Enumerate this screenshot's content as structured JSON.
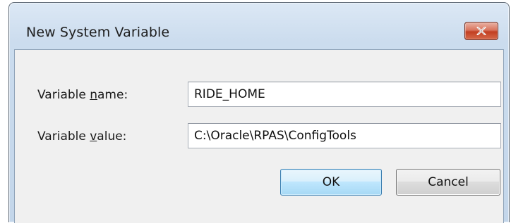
{
  "window": {
    "title": "New System Variable"
  },
  "fields": {
    "name": {
      "label_prefix": "Variable ",
      "label_accel": "n",
      "label_suffix": "ame:",
      "value": "RIDE_HOME"
    },
    "value": {
      "label_prefix": "Variable ",
      "label_accel": "v",
      "label_suffix": "alue:",
      "value": "C:\\Oracle\\RPAS\\ConfigTools"
    }
  },
  "buttons": {
    "ok": "OK",
    "cancel": "Cancel"
  },
  "icons": {
    "close": "close-icon"
  },
  "colors": {
    "close_button": "#c94a2e",
    "ok_border": "#3c7fb1",
    "client_bg": "#f0f0f0"
  }
}
